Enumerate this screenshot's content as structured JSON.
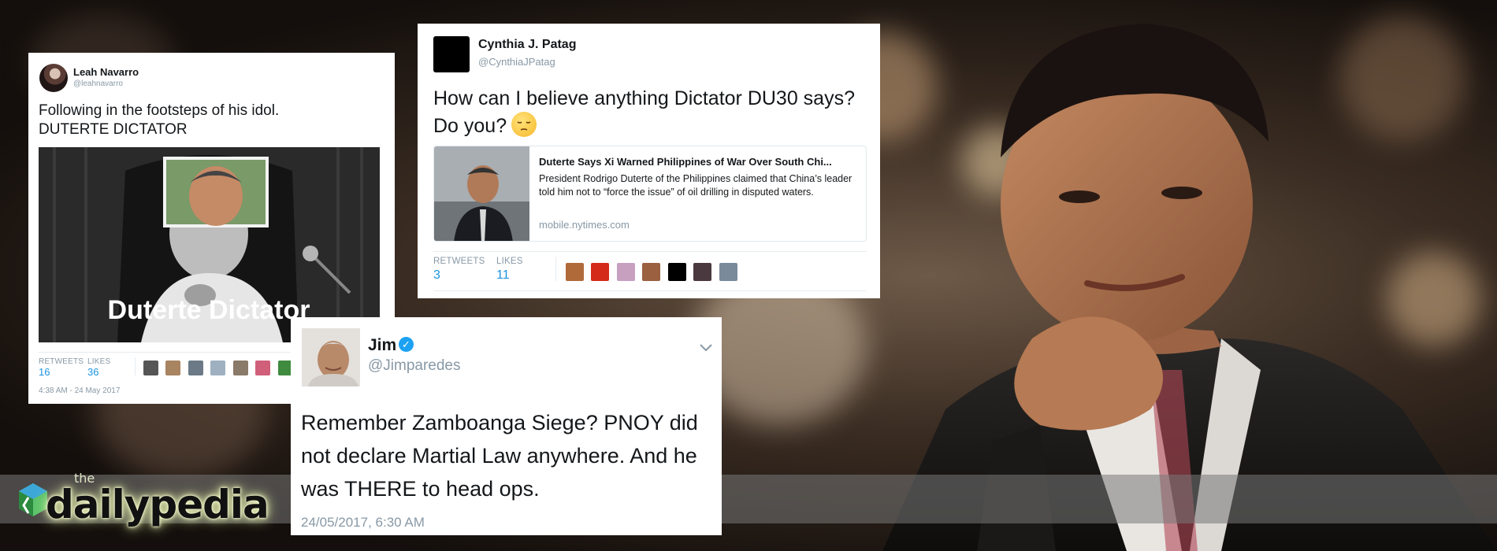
{
  "tweets": {
    "leah": {
      "name": "Leah Navarro",
      "handle": "@leahnavarro",
      "text_line1": "Following in the footsteps of his idol.",
      "text_line2": "DUTERTE DICTATOR",
      "image_caption": "Duterte Dictator",
      "retweets_label": "RETWEETS",
      "retweets": "16",
      "likes_label": "LIKES",
      "likes": "36",
      "timestamp": "4:38 AM - 24 May 2017"
    },
    "cynthia": {
      "name": "Cynthia J. Patag",
      "handle": "@CynthiaJPatag",
      "text": "How can I believe anything Dictator DU30 says?  Do you?",
      "link_title": "Duterte Says Xi Warned Philippines of War Over South Chi...",
      "link_description": "President Rodrigo Duterte of the Philippines claimed that China’s leader told him not to “force the issue” of oil drilling in disputed waters.",
      "link_domain": "mobile.nytimes.com",
      "retweets_label": "RETWEETS",
      "retweets": "3",
      "likes_label": "LIKES",
      "likes": "11"
    },
    "jim": {
      "name": "Jim",
      "handle": "@Jimparedes",
      "verified_glyph": "✓",
      "text": "Remember Zamboanga Siege? PNOY did not declare Martial Law anywhere. And he was THERE to head ops.",
      "timestamp": "24/05/2017, 6:30 AM"
    }
  },
  "logo": {
    "small": "the",
    "word": "dailypedia"
  },
  "colors": {
    "link_blue": "#1b95e0",
    "verified": "#1da1f2",
    "muted": "#8899a6"
  }
}
